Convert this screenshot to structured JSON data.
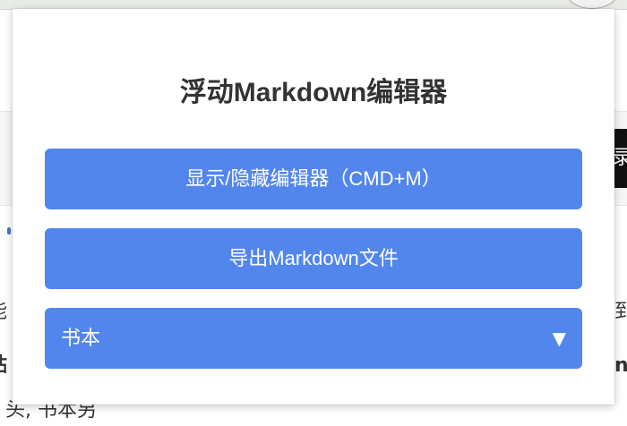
{
  "background": {
    "right_button_text": "录",
    "left_text_fragments": [
      "能",
      "贴",
      "头,  书本另"
    ],
    "right_text_fragments": [
      "到",
      "n"
    ]
  },
  "popup": {
    "title": "浮动Markdown编辑器",
    "toggle_button_label": "显示/隐藏编辑器（CMD+M）",
    "export_button_label": "导出Markdown文件",
    "theme_select": {
      "selected": "书本",
      "arrow": "▼"
    }
  },
  "colors": {
    "button_blue": "#5286ec",
    "title_text": "#333333"
  }
}
